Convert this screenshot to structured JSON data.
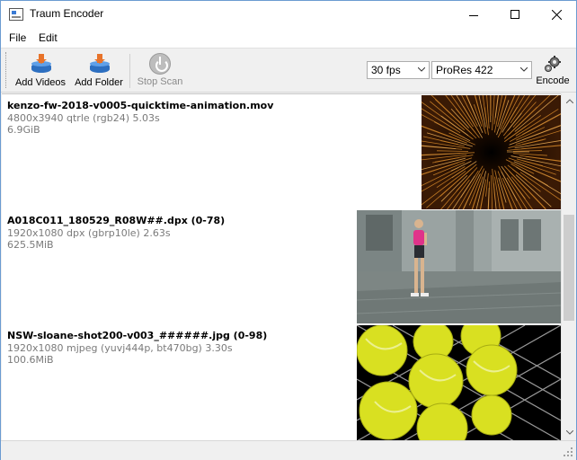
{
  "window": {
    "title": "Traum Encoder"
  },
  "menu": {
    "file": "File",
    "edit": "Edit"
  },
  "toolbar": {
    "add_videos": "Add Videos",
    "add_folder": "Add Folder",
    "stop_scan": "Stop Scan",
    "encode": "Encode",
    "fps_selected": "30 fps",
    "codec_selected": "ProRes 422"
  },
  "items": [
    {
      "title": "kenzo-fw-2018-v0005-quicktime-animation.mov",
      "meta": "4800x3940 qtrle (rgb24) 5.03s",
      "size": "6.9GiB",
      "thumb": "starburst-tunnel-frame"
    },
    {
      "title": "A018C011_180529_R08W##.dpx (0-78)",
      "meta": "1920x1080 dpx (gbrp10le) 2.63s",
      "size": "625.5MiB",
      "thumb": "woman-walking-street-frame"
    },
    {
      "title": "NSW-sloane-shot200-v003_######.jpg (0-98)",
      "meta": "1920x1080 mjpeg (yuvj444p, bt470bg) 3.30s",
      "size": "100.6MiB",
      "thumb": "tennis-balls-fence-frame"
    }
  ],
  "colors": {
    "accent": "#2d6fc0",
    "meta_text": "#7a7a7a",
    "ball": "#d9e021"
  }
}
